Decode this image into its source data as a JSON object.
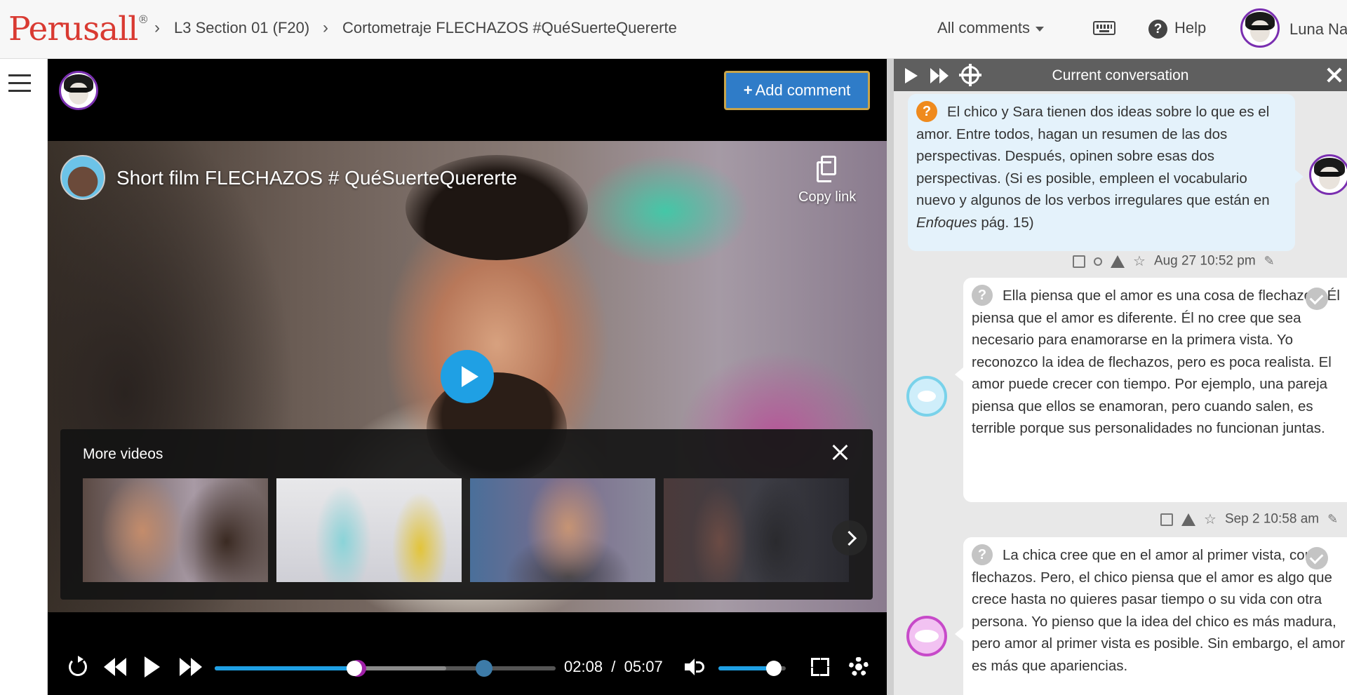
{
  "topbar": {
    "logo": "Perusall",
    "logo_mark": "®",
    "breadcrumb": [
      "L3 Section 01 (F20)",
      "Cortometraje FLECHAZOS #QuéSuerteQuererte"
    ],
    "filter_label": "All comments",
    "help_label": "Help",
    "user_name": "Luna Na"
  },
  "toolbar": {
    "add_comment_label": "Add comment"
  },
  "video": {
    "title": "Short film FLECHAZOS # QuéSuerteQuererte",
    "copy_link_label": "Copy link",
    "more_videos_label": "More videos",
    "current_time": "02:08",
    "time_sep": "/",
    "duration": "05:07",
    "played_fraction": 0.41,
    "buffered_fraction": 0.68,
    "marker_fractions": [
      0.42,
      0.79
    ],
    "volume_fraction": 0.82
  },
  "conversation": {
    "header_title": "Current conversation",
    "question": {
      "text_before": "El chico y Sara tienen dos ideas sobre lo que es el amor. Entre todos, hagan un resumen de las dos perspectivas. Después, opinen sobre esas dos perspectivas. (Si es posible, empleen el vocabulario nuevo y algunos de los verbos irregulares que están en ",
      "text_em": "Enfoques",
      "text_after": " pág. 15)",
      "timestamp": "Aug 27 10:52 pm"
    },
    "replies": [
      {
        "text": "Ella piensa que el amor es una cosa de flechazos. Él piensa que el amor es diferente. Él no cree que sea necesario para enamorarse en la primera vista. Yo reconozco la idea de flechazos, pero es poca realista. El amor puede crecer con tiempo. Por ejemplo, una pareja piensa que ellos se enamoran, pero cuando salen, es terrible porque sus personalidades no funcionan juntas.",
        "timestamp": "Sep 2 10:58 am"
      },
      {
        "text": "La chica cree que en el amor al primer vista, como flechazos. Pero, el chico piensa que el amor es algo que crece hasta no quieres pasar tiempo o su vida con otra persona. Yo pienso que la idea del chico es más madura, pero amor al primer vista es posible. Sin embargo, el amor es más que apariencias."
      }
    ]
  },
  "colors": {
    "brand": "#d93a32",
    "accent": "#1fa0e4",
    "add_button": "#2f7cc8",
    "question_icon": "#ef8a1d"
  }
}
